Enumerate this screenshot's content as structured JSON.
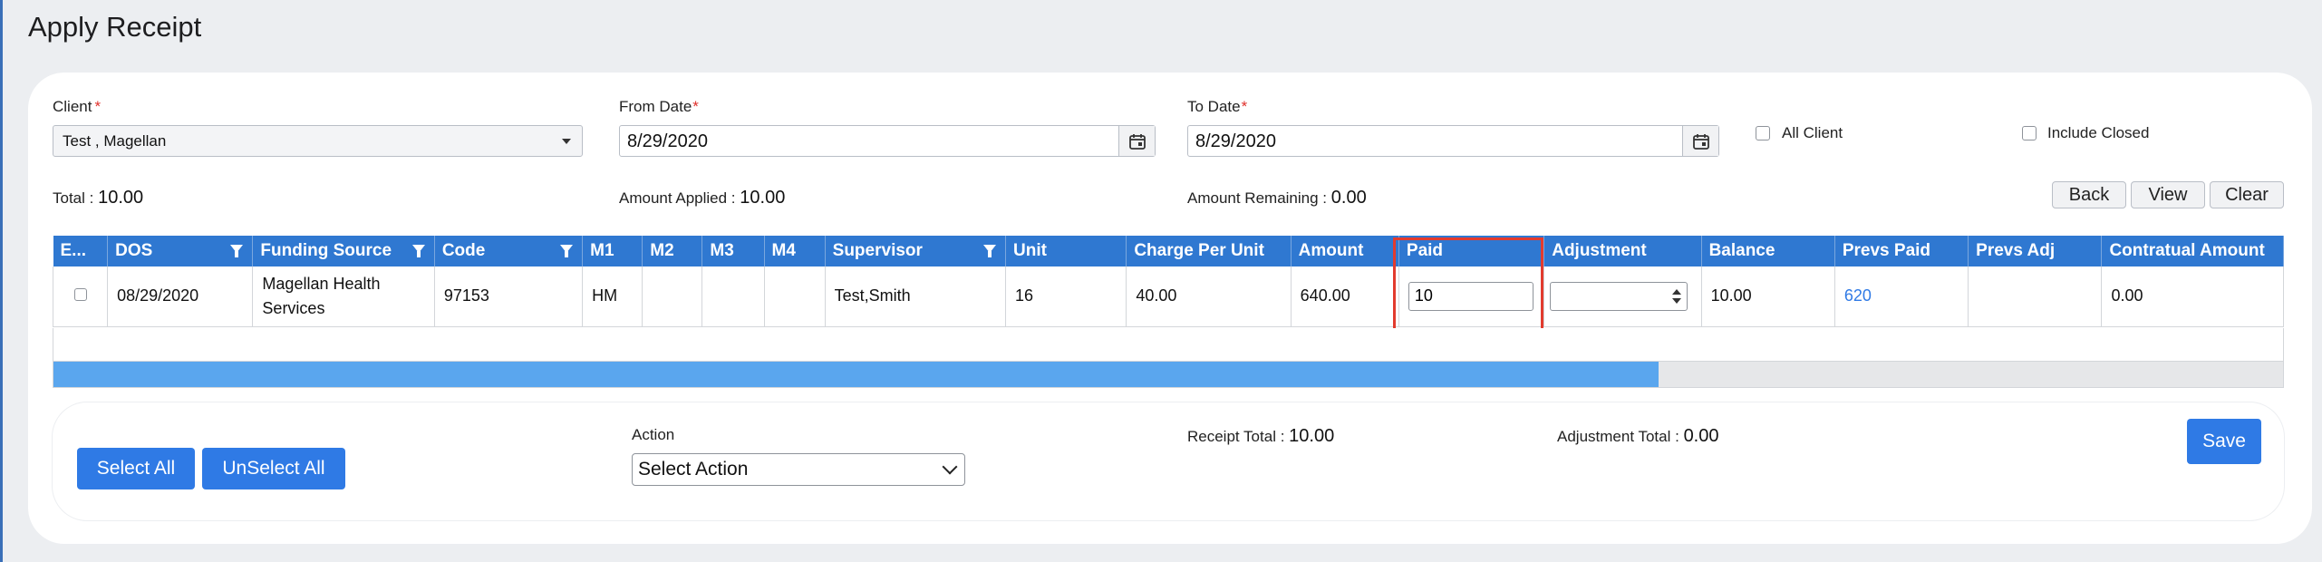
{
  "page": {
    "title": "Apply Receipt"
  },
  "filters": {
    "client_label": "Client",
    "client_value": "Test , Magellan",
    "from_date_label": "From Date",
    "from_date_value": "8/29/2020",
    "to_date_label": "To Date",
    "to_date_value": "8/29/2020",
    "required_mark": "*",
    "all_client_label": "All Client",
    "include_closed_label": "Include Closed"
  },
  "summary": {
    "total_label": "Total :",
    "total_value": "10.00",
    "applied_label": "Amount Applied :",
    "applied_value": "10.00",
    "remaining_label": "Amount Remaining :",
    "remaining_value": "0.00"
  },
  "buttons": {
    "back": "Back",
    "view": "View",
    "clear": "Clear",
    "select_all": "Select All",
    "unselect_all": "UnSelect All",
    "save": "Save"
  },
  "grid": {
    "columns": [
      "E...",
      "DOS",
      "Funding Source",
      "Code",
      "M1",
      "M2",
      "M3",
      "M4",
      "Supervisor",
      "Unit",
      "Charge Per Unit",
      "Amount",
      "Paid",
      "Adjustment",
      "Balance",
      "Prevs Paid",
      "Prevs Adj",
      "Contratual Amount"
    ],
    "row": {
      "dos": "08/29/2020",
      "funding_source": "Magellan Health Services",
      "code": "97153",
      "m1": "HM",
      "m2": "",
      "m3": "",
      "m4": "",
      "supervisor": "Test,Smith",
      "unit": "16",
      "charge_per_unit": "40.00",
      "amount": "640.00",
      "paid": "10",
      "adjustment": "",
      "balance": "10.00",
      "prevs_paid": "620",
      "prevs_adj": "",
      "contratual_amount": "0.00"
    },
    "scroll_fraction": 0.72
  },
  "footer": {
    "action_label": "Action",
    "action_value": "Select Action",
    "receipt_total_label": "Receipt Total :",
    "receipt_total_value": "10.00",
    "adjustment_total_label": "Adjustment Total :",
    "adjustment_total_value": "0.00"
  },
  "colors": {
    "primary": "#2f7ae5",
    "header": "#2f78d1",
    "highlight": "#e23b2e",
    "link": "#2f7ae5"
  }
}
